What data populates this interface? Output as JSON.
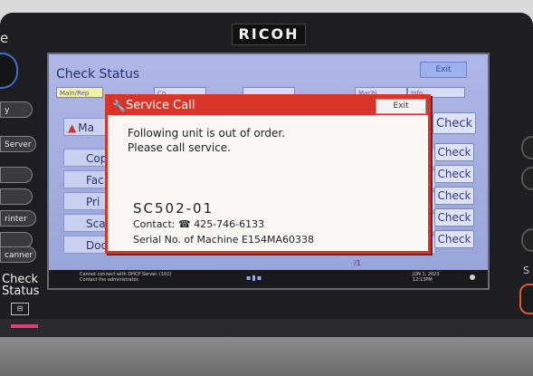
{
  "brand": "RICOH",
  "device_left_buttons": {
    "top_letter": "e",
    "items": [
      "y",
      "Server",
      "",
      "",
      "rinter",
      "",
      "canner"
    ],
    "check_status_line1": "Check",
    "check_status_line2": "Status"
  },
  "right_panel": {
    "s_label": "S"
  },
  "screen": {
    "title": "Check Status",
    "exit_label": "Exit",
    "tabs": [
      "Main/Rep",
      "Co",
      "...",
      "Machi",
      "Info"
    ],
    "warn_item": "Ma",
    "side_items": [
      "Cop",
      "Fac",
      "Pri",
      "Sca",
      "Doc"
    ],
    "check_label": "Check",
    "fragment": "/1",
    "status_message_line1": "Cannot connect with DHCP Server. (101)",
    "status_message_line2": "Contact the administrator.",
    "date": "JUN   1, 2023",
    "time": "12:13PM"
  },
  "dialog": {
    "title": "Service Call",
    "exit_label": "Exit",
    "message_line1": "Following unit is out of order.",
    "message_line2": "Please call service.",
    "code": "SC502-01",
    "contact_label": "Contact:",
    "contact_phone": "425-746-6133",
    "serial_label": "Serial No. of Machine",
    "serial_number": "E154MA60338"
  },
  "colors": {
    "dialog_accent": "#d8342a",
    "screen_bg": "#a6b0e2",
    "bezel": "#1e1e22"
  }
}
